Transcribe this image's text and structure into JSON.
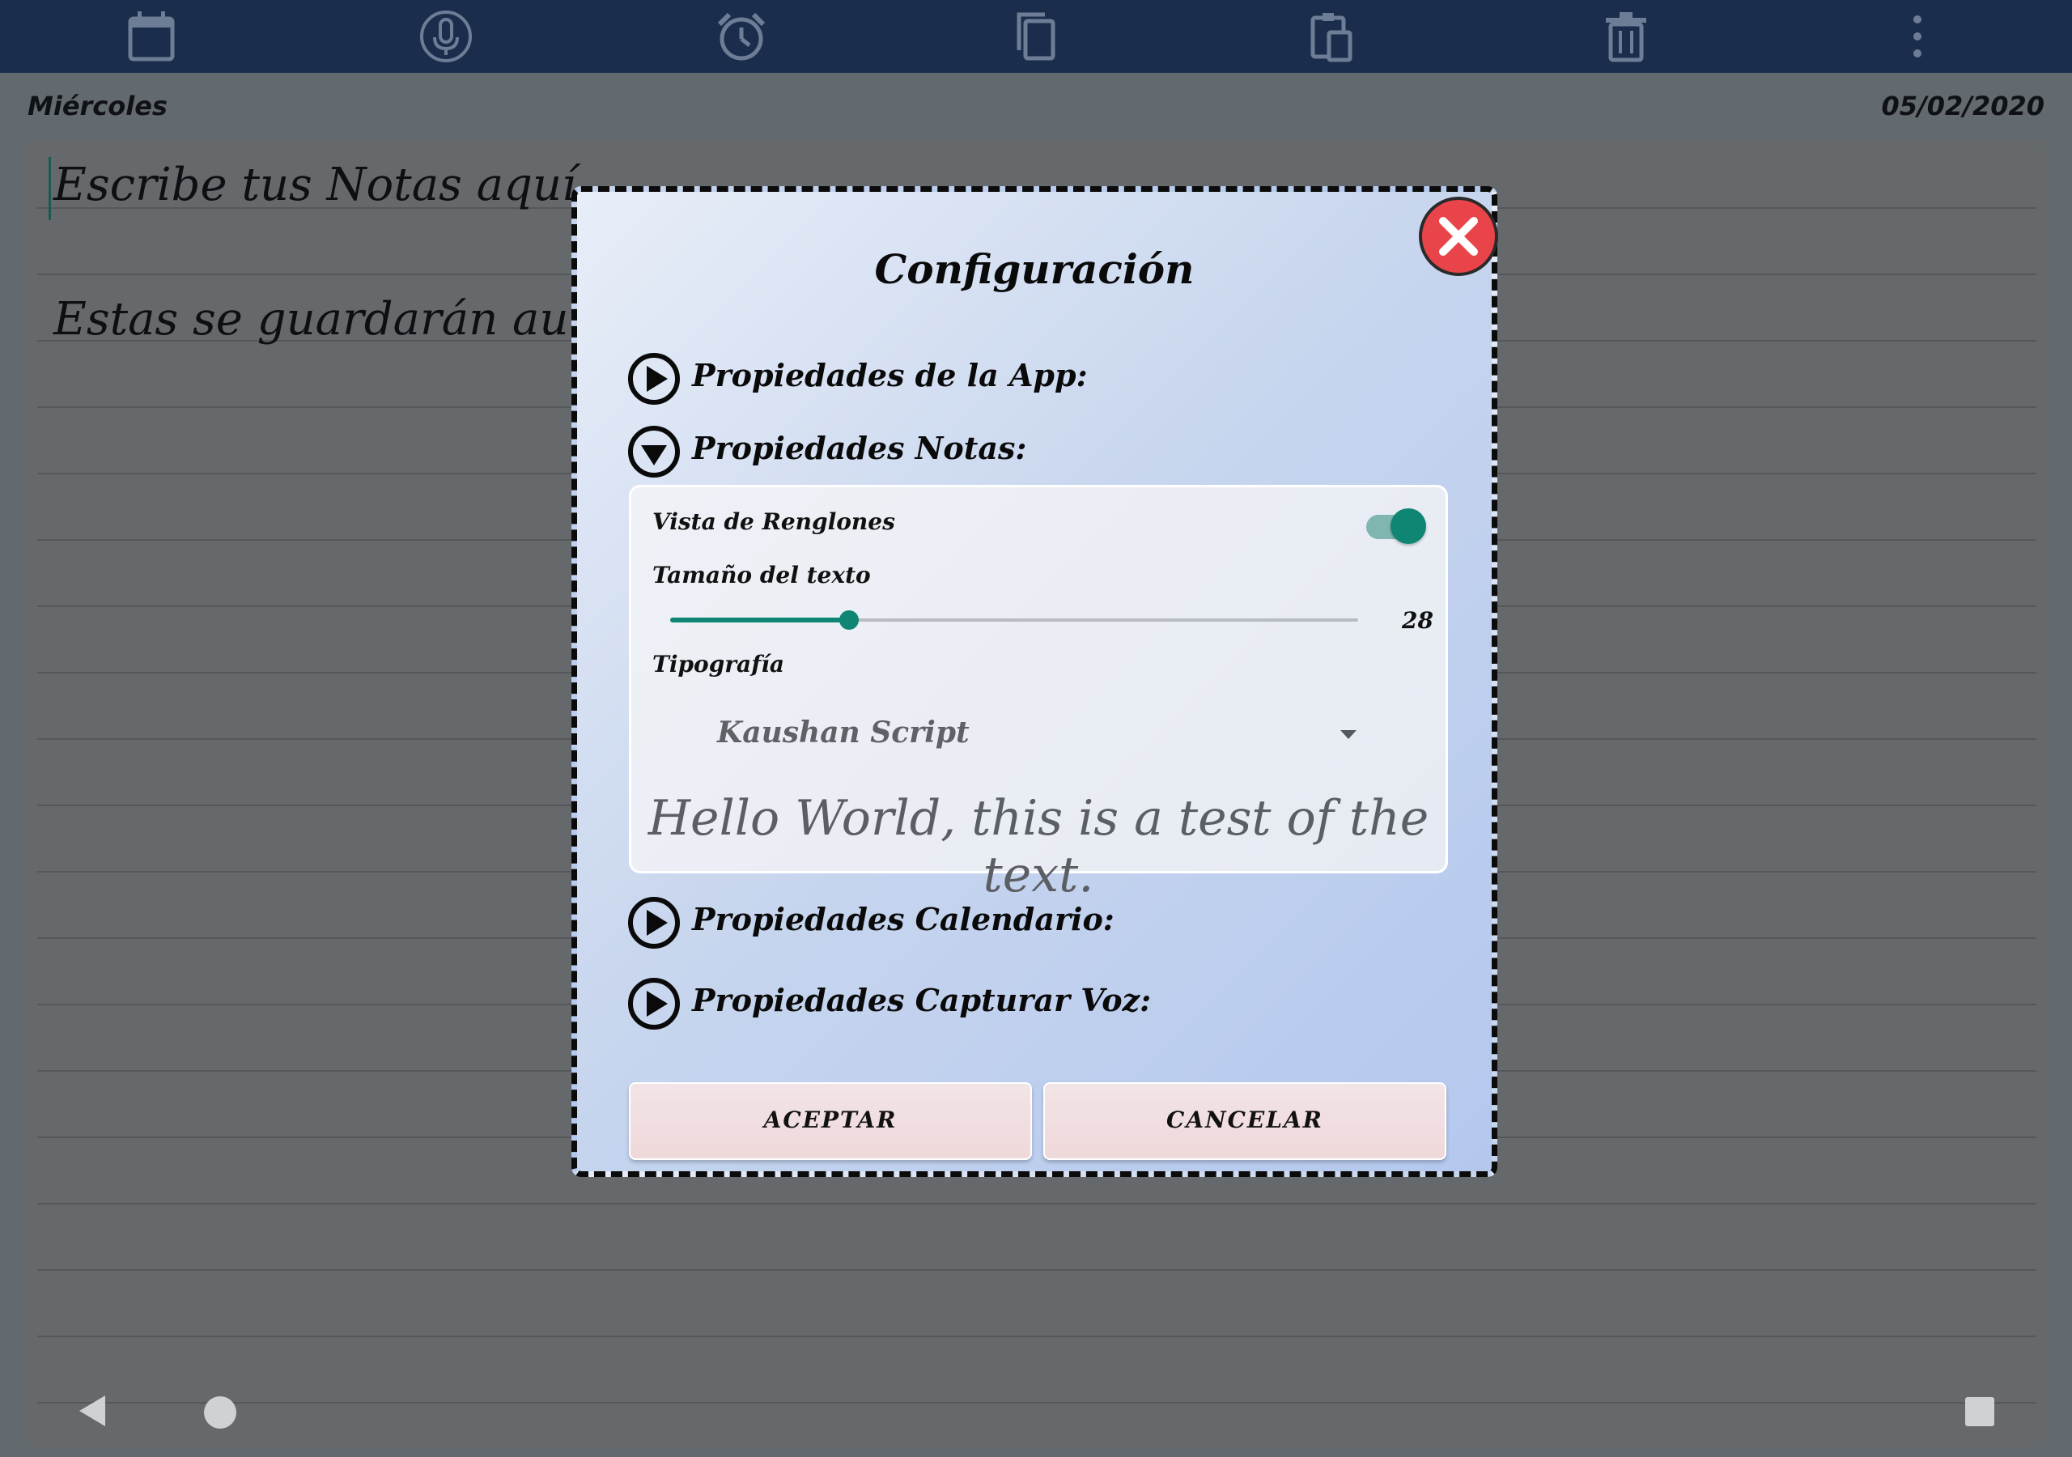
{
  "toolbar": {
    "icons": [
      "calendar-icon",
      "microphone-icon",
      "alarm-icon",
      "copy-icon",
      "paste-icon",
      "trash-icon",
      "more-vertical-icon"
    ]
  },
  "header": {
    "day": "Miércoles",
    "date": "05/02/2020"
  },
  "notes": {
    "line1": "Escribe  tus Notas aquí.",
    "line2": "Estas se guardarán automáticamente."
  },
  "dialog": {
    "title": "Configuración",
    "sections": [
      {
        "label": "Propiedades de la App:",
        "expanded": false
      },
      {
        "label": "Propiedades Notas:",
        "expanded": true
      },
      {
        "label": "Propiedades Calendario:",
        "expanded": false
      },
      {
        "label": "Propiedades Capturar Voz:",
        "expanded": false
      }
    ],
    "notes_panel": {
      "lines_view_label": "Vista de Renglones",
      "lines_view_enabled": true,
      "text_size_label": "Tamaño del texto",
      "text_size_value": "28",
      "text_size_fraction": 0.26,
      "font_label": "Tipografía",
      "font_selected": "Kaushan Script",
      "preview_text": "Hello World, this is a test of the text."
    },
    "buttons": {
      "accept": "ACEPTAR",
      "cancel": "CANCELAR"
    }
  },
  "colors": {
    "toolbar": "#1b2d4c",
    "accent": "#0f8674",
    "close": "#e9444a"
  }
}
